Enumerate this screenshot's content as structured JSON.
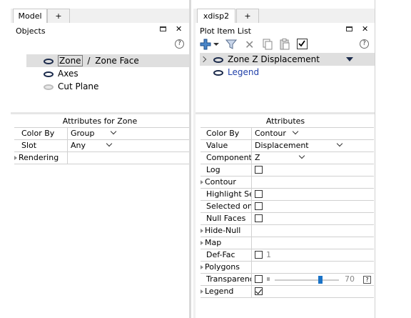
{
  "left": {
    "tabs": [
      {
        "label": "Model"
      },
      {
        "label": "+"
      }
    ],
    "header": {
      "title": "Objects"
    },
    "tree": [
      {
        "label": "Zone",
        "sep": "/",
        "sub": "Zone Face"
      },
      {
        "label": "Axes"
      },
      {
        "label": "Cut Plane"
      }
    ],
    "attributes": {
      "title": "Attributes for Zone",
      "rows": [
        {
          "name": "Color By",
          "value": "Group"
        },
        {
          "name": "Slot",
          "value": "Any"
        },
        {
          "name": "Rendering",
          "value": ""
        }
      ]
    }
  },
  "right": {
    "tabs": [
      {
        "label": "xdisp2"
      },
      {
        "label": "+"
      }
    ],
    "header": {
      "title": "Plot Item List"
    },
    "plot_items": [
      {
        "label": "Zone Z Displacement"
      },
      {
        "label": "Legend"
      }
    ],
    "attributes": {
      "title": "Attributes",
      "rows": [
        {
          "name": "Color By",
          "value": "Contour"
        },
        {
          "name": "Value",
          "value": "Displacement"
        },
        {
          "name": "Component",
          "value": "Z"
        },
        {
          "name": "Log",
          "value": ""
        },
        {
          "name": "Contour",
          "value": ""
        },
        {
          "name": "Highlight Sele",
          "value": ""
        },
        {
          "name": "Selected only",
          "value": ""
        },
        {
          "name": "Null Faces",
          "value": ""
        },
        {
          "name": "Hide-Null",
          "value": ""
        },
        {
          "name": "Map",
          "value": ""
        },
        {
          "name": "Def-Fac",
          "value": "1"
        },
        {
          "name": "Polygons",
          "value": ""
        },
        {
          "name": "Transparency",
          "value": "70"
        },
        {
          "name": "Legend",
          "value": ""
        }
      ]
    }
  },
  "glyphs": {
    "help": "?",
    "add": "+"
  },
  "colors": {
    "selection": "#dfdfdf",
    "eye": "#1c2b4c",
    "legend_text": "#1f3fa8",
    "slider_handle": "#1a73c7"
  }
}
